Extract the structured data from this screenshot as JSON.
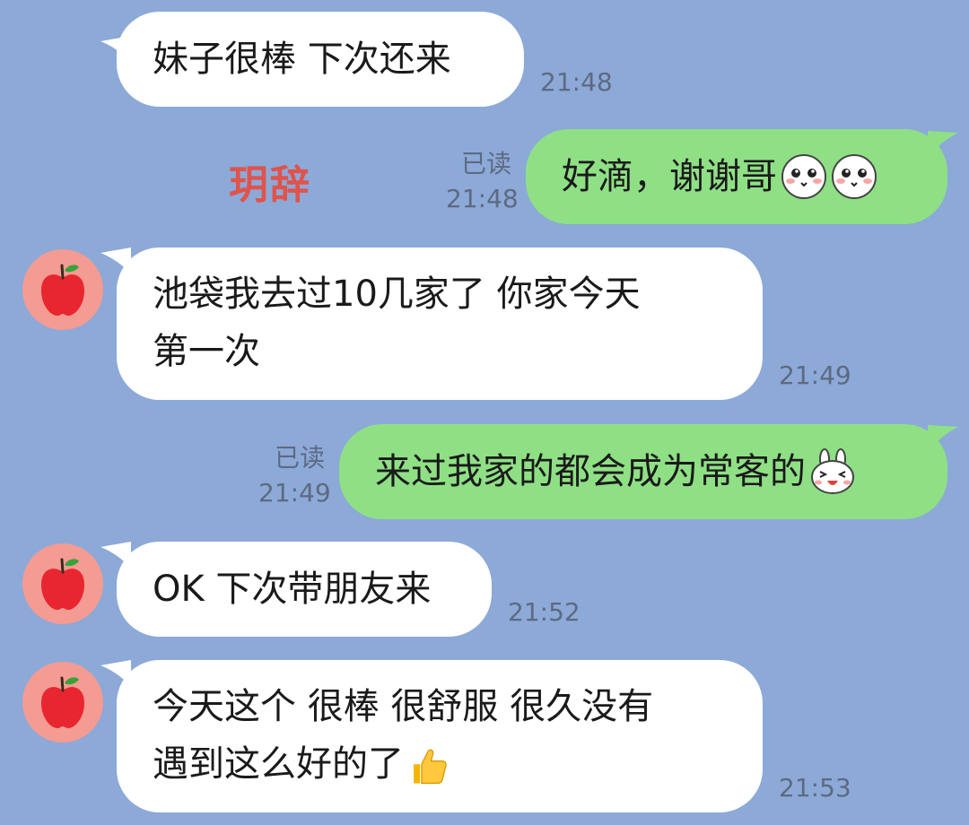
{
  "watermark": "玥辞",
  "messages": [
    {
      "text": "妹子很棒  下次还来",
      "time": "21:48"
    },
    {
      "text": "好滴，谢谢哥",
      "time": "21:48",
      "read": "已读"
    },
    {
      "line1": "池袋我去过10几家了  你家今天",
      "line2": "第一次",
      "time": "21:49"
    },
    {
      "text": "来过我家的都会成为常客的",
      "time": "21:49",
      "read": "已读"
    },
    {
      "text": "OK 下次带朋友来",
      "time": "21:52"
    },
    {
      "line1": "今天这个  很棒 很舒服 很久没有",
      "line2": "遇到这么好的了",
      "time": "21:53"
    }
  ],
  "icons": {
    "avatar": "apple-icon",
    "sticker_blush": "blush-face-icon",
    "sticker_bunny": "bunny-face-icon",
    "thumbs_up": "thumbs-up-icon"
  },
  "colors": {
    "background": "#8ca9d8",
    "incoming_bubble": "#ffffff",
    "outgoing_bubble": "#8fe085",
    "avatar_bg": "#f49b93",
    "watermark": "#e0534a"
  }
}
